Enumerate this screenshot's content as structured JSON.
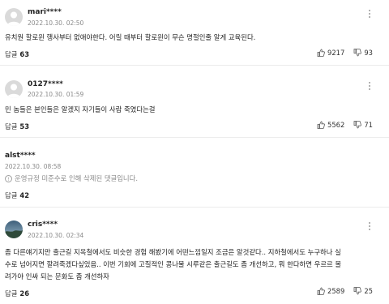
{
  "comments": [
    {
      "author": "mari****",
      "date": "2022.10.30. 02:50",
      "lines": [
        "유치원 할로윈 행사부터 없애야한다. 어릴 때부터 할로윈이 무슨 명절인줄 알게 교육된다."
      ],
      "reply_label": "답글",
      "reply_count": "63",
      "likes": "9217",
      "dislikes": "93",
      "avatar": "default"
    },
    {
      "author": "0127****",
      "date": "2022.10.30. 01:59",
      "lines": [
        "민 놈들은 본인들은 알겠지 자기들이 사람 죽였다는걸"
      ],
      "reply_label": "답글",
      "reply_count": "53",
      "likes": "5562",
      "dislikes": "71",
      "avatar": "default"
    },
    {
      "author": "alst****",
      "date": "2022.10.30. 08:58",
      "deleted_text": "운영규정 미준수로 인해 삭제된 댓글입니다.",
      "reply_label": "답글",
      "reply_count": "42"
    },
    {
      "author": "cris****",
      "date": "2022.10.30. 02:34",
      "lines": [
        "좀 다른얘기지만 출근길 지옥철에서도 비슷한 경험 해봤기에 어떤느낌일지 조금은 알것같다.. 지하철에서도 누구하나 실",
        "수로 넘어지면 깔려죽겠다싶었음.. 이번 기회에 고질적인 콩나물 시루같은 출근길도 좀 개선하고, 뭐 한다하면 우르르 몰",
        "려가야 인싸 되는 문화도 좀 개선하자"
      ],
      "reply_label": "답글",
      "reply_count": "26",
      "likes": "2589",
      "dislikes": "25",
      "avatar": "photo"
    }
  ]
}
